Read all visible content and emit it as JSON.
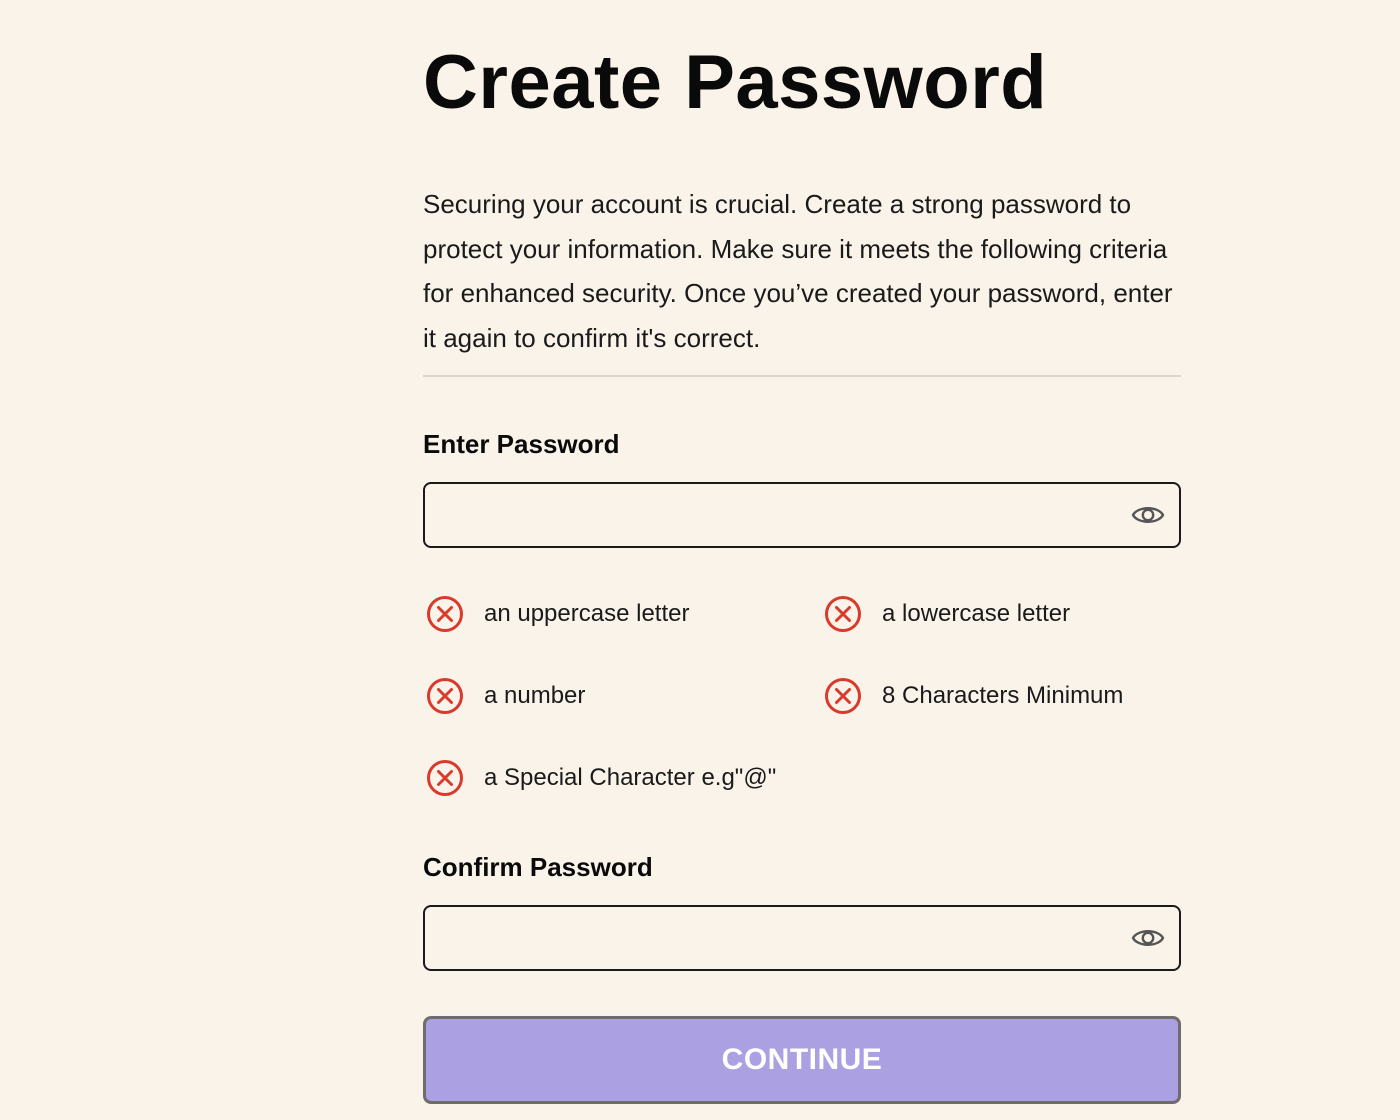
{
  "page": {
    "title": "Create Password",
    "intro": "Securing your account is crucial. Create a strong password to protect your information. Make sure it meets the following criteria for enhanced security. Once you’ve created your password, enter it again to confirm it's correct."
  },
  "password": {
    "label": "Enter Password",
    "value": "",
    "placeholder": "",
    "toggle_icon": "eye-icon"
  },
  "criteria": {
    "status_icon": "x-circle-icon",
    "status_color": "#d93a2b",
    "items": [
      {
        "label": "an uppercase letter",
        "met": false
      },
      {
        "label": "a lowercase letter",
        "met": false
      },
      {
        "label": "a number",
        "met": false
      },
      {
        "label": "8 Characters Minimum",
        "met": false
      },
      {
        "label": "a Special Character e.g\"@\"",
        "met": false
      }
    ]
  },
  "confirm": {
    "label": "Confirm Password",
    "value": "",
    "placeholder": "",
    "toggle_icon": "eye-icon"
  },
  "continue_button": {
    "label": "CONTINUE",
    "background": "#aba1e2",
    "enabled": false
  }
}
